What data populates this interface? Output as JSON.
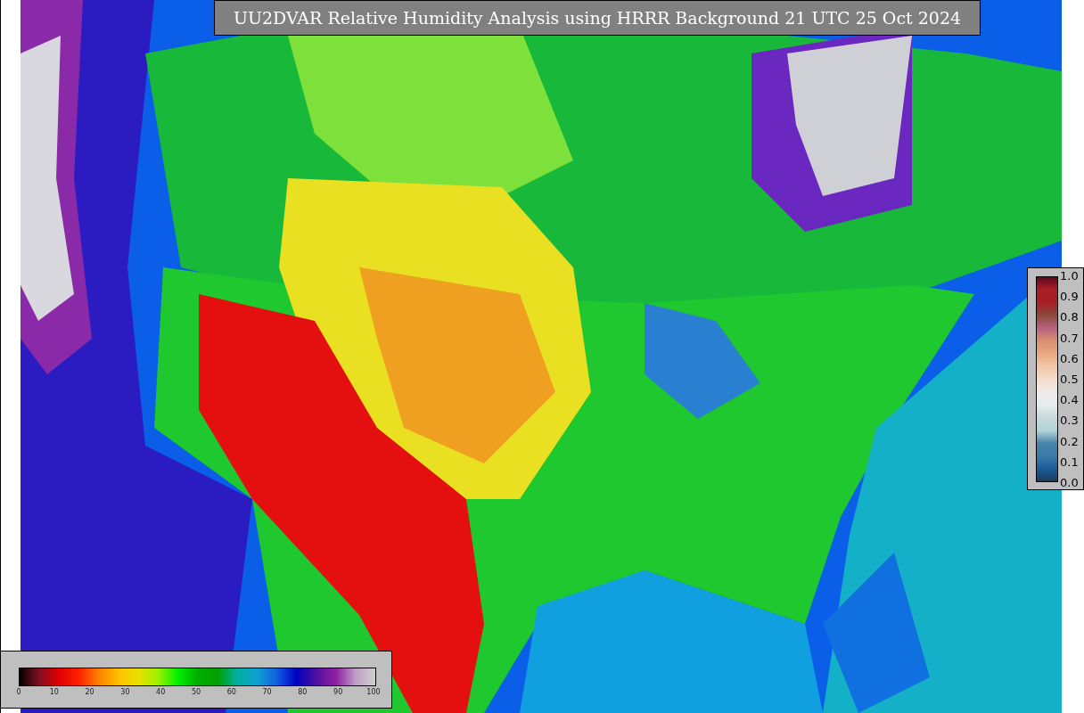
{
  "title": "UU2DVAR Relative Humidity Analysis using HRRR Background 21 UTC 25 Oct 2024",
  "fraction_legend": {
    "ticks": [
      "1.0",
      "0.9",
      "0.8",
      "0.7",
      "0.6",
      "0.5",
      "0.4",
      "0.3",
      "0.2",
      "0.1",
      "0.0"
    ]
  },
  "percent_legend": {
    "ticks": [
      "0",
      "10",
      "20",
      "30",
      "40",
      "50",
      "60",
      "70",
      "80",
      "90",
      "100"
    ]
  }
}
